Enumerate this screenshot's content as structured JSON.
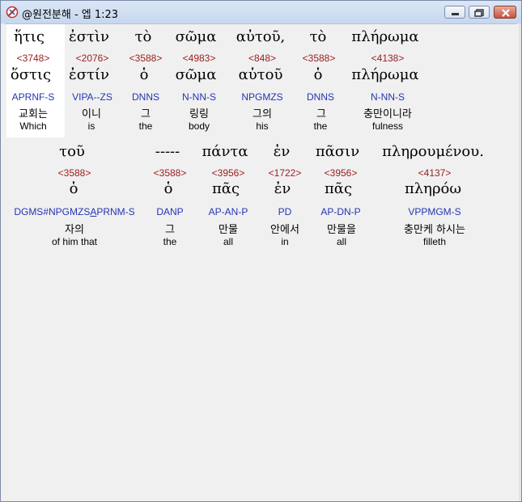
{
  "window": {
    "title": "@원전분해 - 엡 1:23"
  },
  "row1": {
    "greek": [
      "ἥτις",
      "ἐστὶν",
      "τὸ",
      "σῶμα",
      "αὐτοῦ,",
      "τὸ",
      "πλήρωμα"
    ],
    "strong": [
      "<3748>",
      "<2076>",
      "<3588>",
      "<4983>",
      "<848>",
      "<3588>",
      "<4138>"
    ],
    "lemma": [
      "ὅστις",
      "ἐστίν",
      "ὁ",
      "σῶμα",
      "αὐτοῦ",
      "ὁ",
      "πλήρωμα"
    ],
    "code": [
      "APRNF-S",
      "VIPA--ZS",
      "DNNS",
      "N-NN-S",
      "NPGMZS",
      "DNNS",
      "N-NN-S"
    ],
    "korean": [
      "교회는",
      "이니",
      "그",
      "링링",
      "그의",
      "그",
      "충만이니라"
    ],
    "english": [
      "Which",
      "is",
      "the",
      "body",
      "his",
      "the",
      "fulness"
    ]
  },
  "row2": {
    "greek": [
      "τοῦ",
      "-----",
      "πάντα",
      "ἐν",
      "πᾶσιν",
      "πληρουμένου."
    ],
    "strong": [
      "<3588>",
      "<3956>",
      "<1722>",
      "<3956>",
      "<4137>"
    ],
    "lemma": [
      "ὁ",
      "ὁ",
      "πᾶς",
      "ἐν",
      "πᾶς",
      "πληρόω"
    ],
    "code_a": "DGMS#NPGMZS",
    "code_b": "A",
    "code_c": "PRNM-S",
    "code": [
      "DANP",
      "AP-AN-P",
      "PD",
      "AP-DN-P",
      "VPPMGM-S"
    ],
    "korean": [
      "자의",
      "그",
      "만물",
      "안에서",
      "만물을",
      "충만케 하시는"
    ],
    "english": [
      "of him that",
      "the",
      "all",
      "in",
      "all",
      "filleth"
    ]
  },
  "row2_strong_dash": "<3588>"
}
